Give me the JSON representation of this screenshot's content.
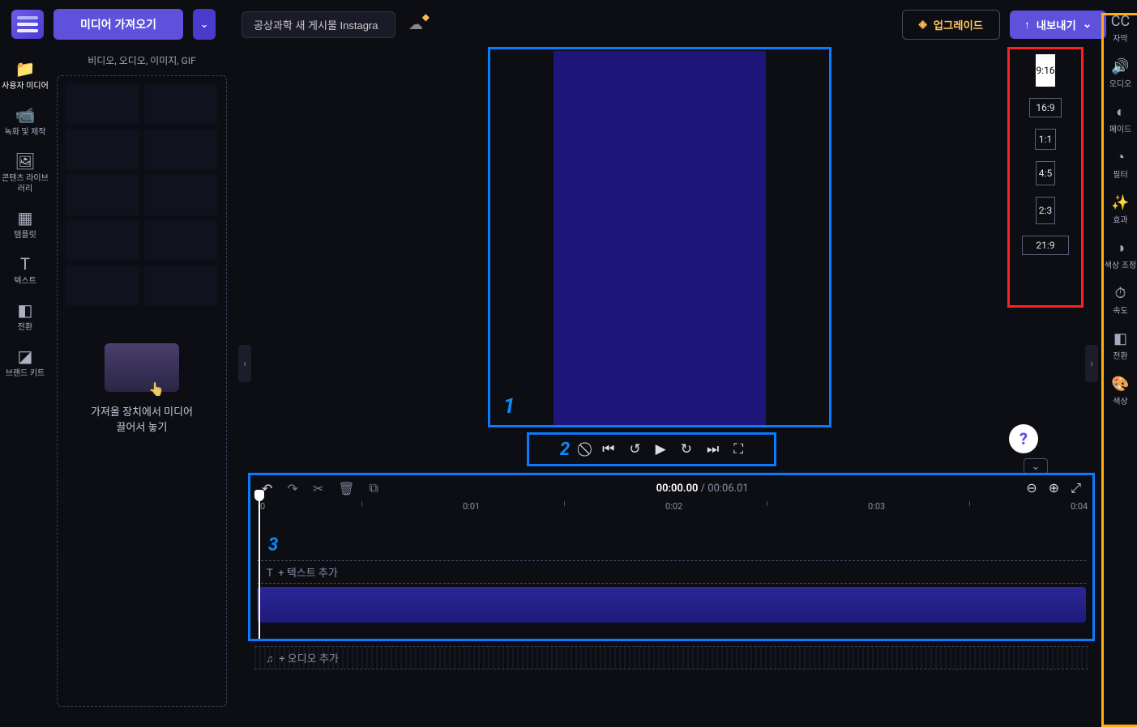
{
  "header": {
    "import_label": "미디어 가져오기",
    "project_title": "공상과학 새 게시물 Instagra",
    "upgrade_label": "업그레이드",
    "export_label": "내보내기"
  },
  "left_nav": [
    {
      "label": "사용자 미디어",
      "icon": "📁",
      "active": true
    },
    {
      "label": "녹화 및 제작",
      "icon": "📹"
    },
    {
      "label": "콘텐츠 라이브러리",
      "icon": "🖼"
    },
    {
      "label": "템플릿",
      "icon": "▦"
    },
    {
      "label": "텍스트",
      "icon": "T"
    },
    {
      "label": "전환",
      "icon": "◧"
    },
    {
      "label": "브랜드 키트",
      "icon": "◪"
    }
  ],
  "media_panel": {
    "subtitle": "비디오, 오디오, 이미지, GIF",
    "drop_line1": "가져올 장치에서 미디어",
    "drop_line2": "끌어서 놓기"
  },
  "aspect_ratios": [
    {
      "label": "9:16",
      "cls": "ar-9-16",
      "active": true
    },
    {
      "label": "16:9",
      "cls": "ar-16-9"
    },
    {
      "label": "1:1",
      "cls": "ar-1-1"
    },
    {
      "label": "4:5",
      "cls": "ar-4-5"
    },
    {
      "label": "2:3",
      "cls": "ar-2-3"
    },
    {
      "label": "21:9",
      "cls": "ar-21-9"
    }
  ],
  "right_rail": [
    {
      "label": "자막",
      "icon": "CC"
    },
    {
      "label": "오디오",
      "icon": "🔊"
    },
    {
      "label": "페이드",
      "icon": "◐"
    },
    {
      "label": "필터",
      "icon": "◔"
    },
    {
      "label": "효과",
      "icon": "✨"
    },
    {
      "label": "색상 조정",
      "icon": "◑"
    },
    {
      "label": "속도",
      "icon": "⏱"
    },
    {
      "label": "전환",
      "icon": "◧"
    },
    {
      "label": "색상",
      "icon": "🎨"
    }
  ],
  "timeline": {
    "current": "00:00.00",
    "duration": "00:06.01",
    "ruler": [
      "0",
      "0:01",
      "0:02",
      "0:03",
      "0:04"
    ],
    "text_track": "+ 텍스트 추가",
    "audio_row": "+ 오디오 추가"
  },
  "annotations": {
    "one": "1",
    "two": "2",
    "three": "3"
  }
}
